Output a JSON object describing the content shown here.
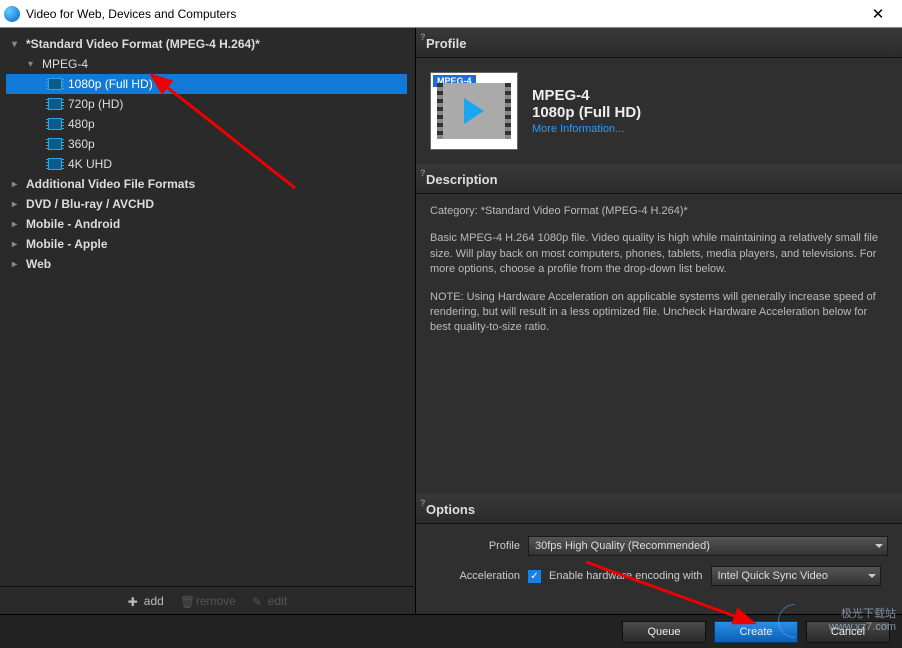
{
  "window": {
    "title": "Video for Web, Devices and Computers"
  },
  "tree": {
    "groups": [
      {
        "label": "*Standard Video Format (MPEG-4 H.264)*",
        "expanded": true
      },
      {
        "label": "MPEG-4",
        "expanded": true,
        "sub": true
      },
      {
        "label": "Additional Video File Formats"
      },
      {
        "label": "DVD / Blu-ray / AVCHD"
      },
      {
        "label": "Mobile - Android"
      },
      {
        "label": "Mobile - Apple"
      },
      {
        "label": "Web"
      }
    ],
    "items": [
      {
        "label": "1080p (Full HD)",
        "selected": true
      },
      {
        "label": "720p (HD)"
      },
      {
        "label": "480p"
      },
      {
        "label": "360p"
      },
      {
        "label": "4K UHD"
      }
    ]
  },
  "leftToolbar": {
    "add": "add",
    "remove": "remove",
    "edit": "edit"
  },
  "profile": {
    "heading": "Profile",
    "badge": "MPEG-4",
    "title": "MPEG-4",
    "subtitle": "1080p (Full HD)",
    "link": "More Information..."
  },
  "description": {
    "heading": "Description",
    "category": "Category: *Standard Video Format (MPEG-4 H.264)*",
    "p1": "Basic MPEG-4 H.264 1080p file. Video quality is high while maintaining a relatively small file size. Will play back on most computers, phones, tablets, media players, and televisions. For more options, choose a profile from the drop-down list below.",
    "p2": "NOTE: Using Hardware Acceleration on applicable systems will generally increase speed of rendering, but will result in a less optimized file. Uncheck Hardware Acceleration below for best quality-to-size ratio."
  },
  "options": {
    "heading": "Options",
    "profileLabel": "Profile",
    "profileValue": "30fps High Quality (Recommended)",
    "accelLabel": "Acceleration",
    "accelCheckLabel": "Enable hardware encoding with",
    "accelEncoder": "Intel Quick Sync Video"
  },
  "footer": {
    "queue": "Queue",
    "create": "Create",
    "cancel": "Cancel"
  },
  "watermark": {
    "line1": "极光下载站",
    "line2": "www.xz7.com"
  }
}
